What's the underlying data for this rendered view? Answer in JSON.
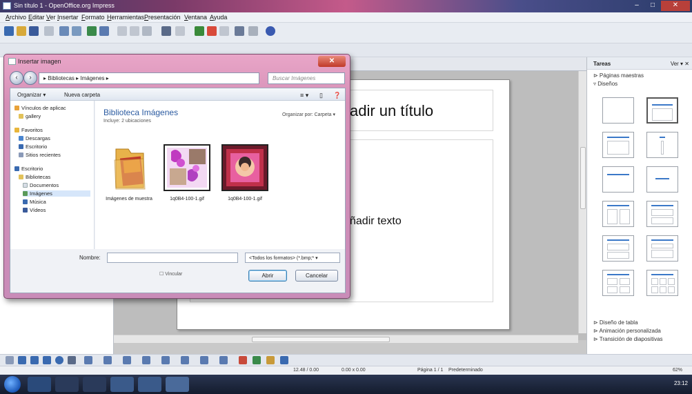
{
  "window": {
    "title": "Sin título 1 - OpenOffice.org Impress",
    "minimize": "–",
    "maximize": "□",
    "close": "✕"
  },
  "menu": [
    "Archivo",
    "Editar",
    "Ver",
    "Insertar",
    "Formato",
    "Herramientas",
    "Presentación",
    "Ventana",
    "Ayuda"
  ],
  "slide": {
    "title_placeholder": "adir un título",
    "body_placeholder": "ñadir texto"
  },
  "tasks": {
    "title": "Tareas",
    "view": "Ver ▾ ✕",
    "sections_top": [
      "⊳ Páginas maestras",
      "▿ Diseños"
    ],
    "sections_bottom": [
      "⊳ Diseño de tabla",
      "⊳ Animación personalizada",
      "⊳ Transición de diapositivas"
    ]
  },
  "statusbar": {
    "position": "12.48 / 0.00",
    "size": "0.00 x 0.00",
    "slide": "Página 1 / 1",
    "layout": "Predeterminado",
    "zoom": "62%"
  },
  "taskbar": {
    "time": "23:12"
  },
  "dialog": {
    "title": "Insertar imagen",
    "close": "✕",
    "address": "▸ Bibliotecas ▸ Imágenes ▸",
    "search_placeholder": "Buscar Imágenes",
    "organize": "Organizar ▾",
    "new_folder": "Nueva carpeta",
    "nav_items": [
      {
        "label": "Vínculos de aplicac",
        "color": "#e8a23a"
      },
      {
        "label": "gallery",
        "color": "#e2c25a"
      },
      {
        "label": "Favoritos",
        "color": "#e9b63b"
      },
      {
        "label": "Descargas",
        "color": "#4a86d0"
      },
      {
        "label": "Escritorio",
        "color": "#3a6ab0"
      },
      {
        "label": "Sitios recientes",
        "color": "#8a9ab8"
      },
      {
        "label": "Escritorio",
        "color": "#3a6ab0"
      },
      {
        "label": "Bibliotecas",
        "color": "#e2c25a"
      },
      {
        "label": "Documentos",
        "color": "#d8dde6"
      },
      {
        "label": "Imágenes",
        "color": "#5a9a5a"
      },
      {
        "label": "Música",
        "color": "#3a6ab0"
      },
      {
        "label": "Vídeos",
        "color": "#3a5a9a"
      }
    ],
    "library_title": "Biblioteca Imágenes",
    "library_sub": "Incluye: 2 ubicaciones",
    "arrange": "Organizar por:  Carpeta ▾",
    "files": [
      {
        "name": "Imágenes de muestra"
      },
      {
        "name": "1q0B4-100-1.gif"
      },
      {
        "name": "1q0B4-100-1.gif"
      }
    ],
    "filename_label": "Nombre:",
    "filename_value": "",
    "filetype": "<Todos los formatos> (*.bmp;* ▾",
    "preview": "☐ Vincular",
    "open_button": "Abrir",
    "cancel_button": "Cancelar"
  }
}
